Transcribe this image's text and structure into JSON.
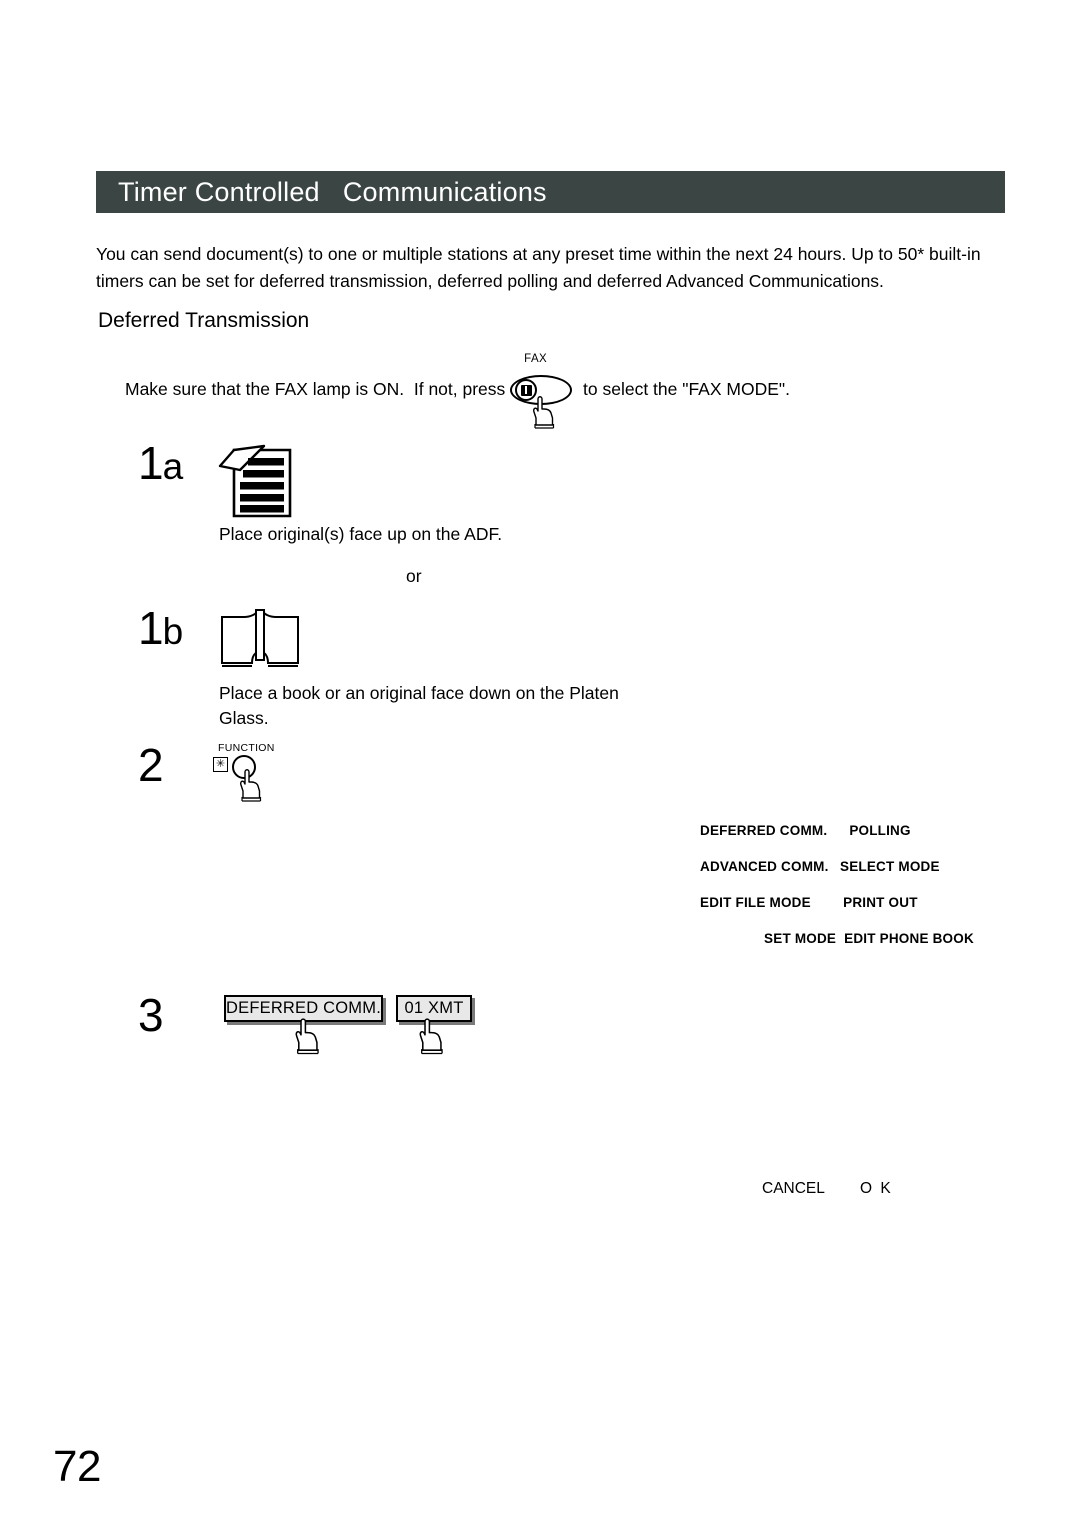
{
  "header": {
    "title": "Timer Controlled   Communications",
    "bar_color": "#3b4644",
    "text_color": "#ffffff"
  },
  "intro": {
    "paragraph": "You can send document(s) to one or multiple stations at any preset time within the next 24 hours. Up to 50* built-in timers can be set for deferred transmission, deferred polling and deferred Advanced Communications."
  },
  "subheading": {
    "title": "Deferred Transmission"
  },
  "fax_line": {
    "before": "Make sure that the FAX lamp is ON.  If not, press ",
    "button_label": "FAX",
    "after": " to select the \"FAX MODE\"."
  },
  "steps": {
    "step1a": {
      "number": "1",
      "letter": "a",
      "icon": "document-stack-icon",
      "caption": "Place original(s) face up on the ADF."
    },
    "or_text": "or",
    "step1b": {
      "number": "1",
      "letter": "b",
      "icon": "open-book-icon",
      "caption": "Place a book or an original face down on the Platen Glass."
    },
    "step2": {
      "number": "2",
      "key_label": "FUNCTION",
      "star_glyph": "✳"
    },
    "step3": {
      "number": "3",
      "buttons": [
        {
          "label": "DEFERRED COMM."
        },
        {
          "label": "01 XMT"
        }
      ]
    }
  },
  "menu_panel": {
    "rows": [
      {
        "left": "DEFERRED COMM.",
        "right": "POLLING"
      },
      {
        "left": "ADVANCED COMM.",
        "right": "SELECT MODE"
      },
      {
        "left": "EDIT FILE MODE",
        "right": "PRINT OUT"
      },
      {
        "left": "SET MODE",
        "right": "EDIT PHONE BOOK"
      }
    ]
  },
  "softkeys": {
    "cancel": "CANCEL",
    "ok": "O K"
  },
  "footer": {
    "page_number": "72"
  }
}
